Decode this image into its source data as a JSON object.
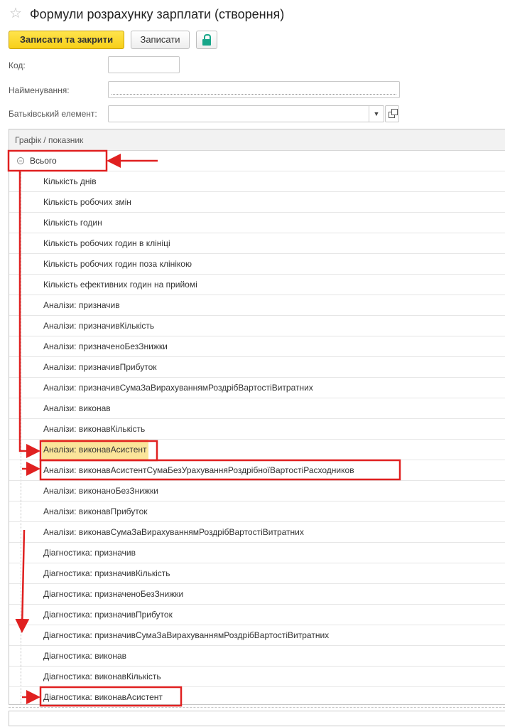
{
  "window": {
    "title": "Формули розрахунку зарплати (створення)",
    "icon": "star-icon"
  },
  "toolbar": {
    "save_close_label": "Записати та закрити",
    "save_label": "Записати",
    "lock_icon": "lock-icon"
  },
  "form": {
    "code_label": "Код:",
    "code_value": "",
    "name_label": "Найменування:",
    "name_value": "",
    "parent_label": "Батьківський елемент:",
    "parent_value": ""
  },
  "table": {
    "header": "Графік / показник",
    "root": "Всього",
    "rows": [
      "Кількість днів",
      "Кількість робочих змін",
      "Кількість годин",
      "Кількість робочих годин в клініці",
      "Кількість робочих годин поза клінікою",
      "Кількість ефективних годин на прийомі",
      "Аналізи: призначив",
      "Аналізи: призначивКількість",
      "Аналізи: призначеноБезЗнижки",
      "Аналізи: призначивПрибуток",
      "Аналізи: призначивСумаЗаВирахуваннямРоздрібВартостіВитратних",
      "Аналізи: виконав",
      "Аналізи: виконавКількість",
      "Аналізи: виконавАсистент",
      "Аналізи: виконавАсистентСумаБезУрахуванняРоздрібноїВартостіРасходников",
      "Аналізи: виконаноБезЗнижки",
      "Аналізи: виконавПрибуток",
      "Аналізи: виконавСумаЗаВирахуваннямРоздрібВартостіВитратних",
      "Діагностика: призначив",
      "Діагностика: призначивКількість",
      "Діагностика: призначеноБезЗнижки",
      "Діагностика: призначивПрибуток",
      "Діагностика: призначивСумаЗаВирахуваннямРоздрібВартостіВитратних",
      "Діагностика: виконав",
      "Діагностика: виконавКількість",
      "Діагностика: виконавАсистент"
    ],
    "selected_index": 13
  },
  "colors": {
    "primary_button": "#f7cf18",
    "selection": "#fbe59a",
    "annotation": "#e02020",
    "lock": "#17a689"
  }
}
